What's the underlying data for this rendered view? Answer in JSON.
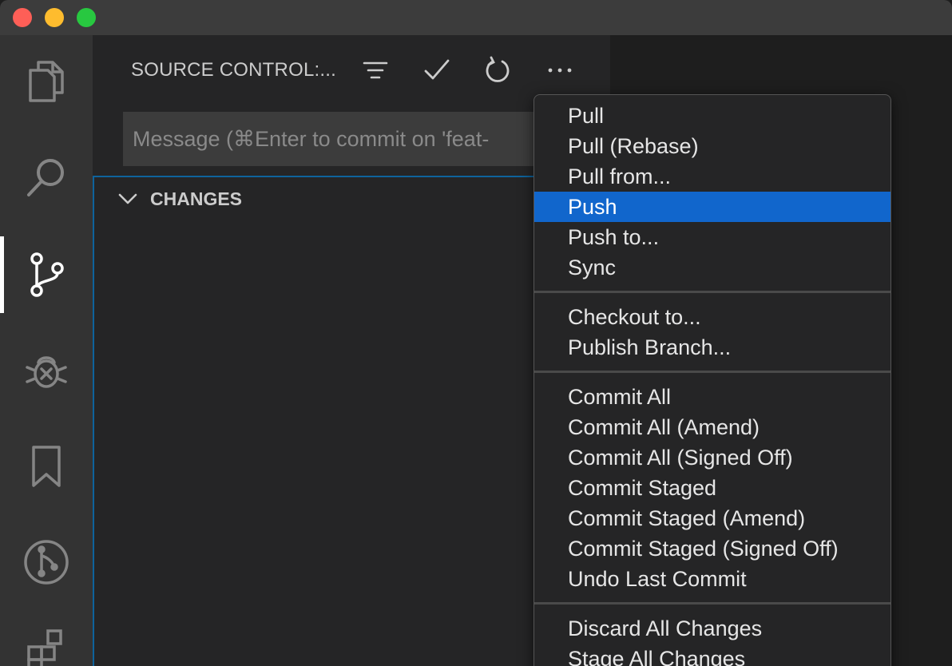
{
  "sidebar": {
    "title": "SOURCE CONTROL:...",
    "commit_placeholder": "Message (⌘Enter to commit on 'feat-",
    "changes_label": "CHANGES"
  },
  "icons": {
    "activity": [
      "files-icon",
      "search-icon",
      "source-control-icon",
      "debug-icon",
      "bookmark-icon",
      "git-graph-icon",
      "extensions-icon"
    ],
    "actions": [
      "filter-icon",
      "check-icon",
      "refresh-icon",
      "more-icon"
    ]
  },
  "menu": {
    "groups": [
      [
        "Pull",
        "Pull (Rebase)",
        "Pull from...",
        "Push",
        "Push to...",
        "Sync"
      ],
      [
        "Checkout to...",
        "Publish Branch..."
      ],
      [
        "Commit All",
        "Commit All (Amend)",
        "Commit All (Signed Off)",
        "Commit Staged",
        "Commit Staged (Amend)",
        "Commit Staged (Signed Off)",
        "Undo Last Commit"
      ],
      [
        "Discard All Changes",
        "Stage All Changes"
      ]
    ],
    "highlighted": "Push"
  },
  "colors": {
    "highlight": "#1166cc",
    "focus_border": "#0e639c",
    "activity_bar": "#333333",
    "sidebar": "#252526"
  }
}
